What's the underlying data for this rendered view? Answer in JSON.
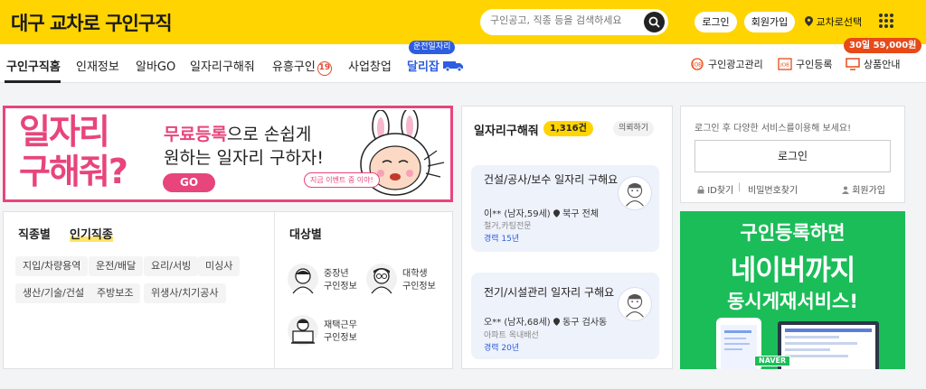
{
  "header": {
    "logo_prefix": "대구",
    "logo_bold": "교차로",
    "logo_suffix": "구인구직",
    "search_placeholder": "구인공고, 직종 등을 검색하세요",
    "login": "로그인",
    "signup": "회원가입",
    "region": "교차로선택"
  },
  "nav": {
    "items": [
      "구인구직홈",
      "인재정보",
      "알바GO",
      "일자리구해줘",
      "유흥구인",
      "사업창업"
    ],
    "adult_badge": "19",
    "delivery_tag": "운전일자리",
    "delivery_label": "달리잡",
    "price_tag": "30일 59,000원",
    "right_items": [
      "구인광고관리",
      "구인등록",
      "상품안내"
    ]
  },
  "banner": {
    "big_line1": "일자리",
    "big_line2": "구해줘?",
    "line1_highlight": "무료등록",
    "line1_rest": "으로 손쉽게",
    "line2": "원하는 일자리 구하자!",
    "go": "GO",
    "event": "지금 이벤트 중 이야!"
  },
  "jobtype": {
    "tab1": "직종별",
    "tab2": "인기직종",
    "tags": [
      "지입/차량용역",
      "운전/배달",
      "요리/서빙",
      "미싱사",
      "생산/기술/건설",
      "주방보조",
      "위생사/치기공사"
    ]
  },
  "target": {
    "title": "대상별",
    "items": [
      {
        "line1": "중장년",
        "line2": "구인정보"
      },
      {
        "line1": "대학생",
        "line2": "구인정보"
      },
      {
        "line1": "재택근무",
        "line2": "구인정보"
      }
    ]
  },
  "jobseek": {
    "title": "일자리구해줘",
    "count": "1,316건",
    "more": "의뢰하기",
    "items": [
      {
        "title": "건설/공사/보수 일자리 구해요",
        "who": "이** (남자,59세)",
        "loc": "북구 전체",
        "sub": "철거,카팅전문",
        "career": "경력 15년"
      },
      {
        "title": "전기/시설관리 일자리 구해요",
        "who": "오** (남자,68세)",
        "loc": "동구 검사동",
        "sub": "아파트 옥내배선",
        "career": "경력 20년"
      }
    ]
  },
  "login_box": {
    "notice": "로그인 후 다양한 서비스를이용해 보세요!",
    "button": "로그인",
    "id_find": "ID찾기",
    "pw_find": "비밀번호찾기",
    "signup": "회원가입"
  },
  "promo": {
    "line1": "구인등록하면",
    "line2": "네이버까지",
    "line3": "동시게재서비스!",
    "naver": "NAVER"
  }
}
